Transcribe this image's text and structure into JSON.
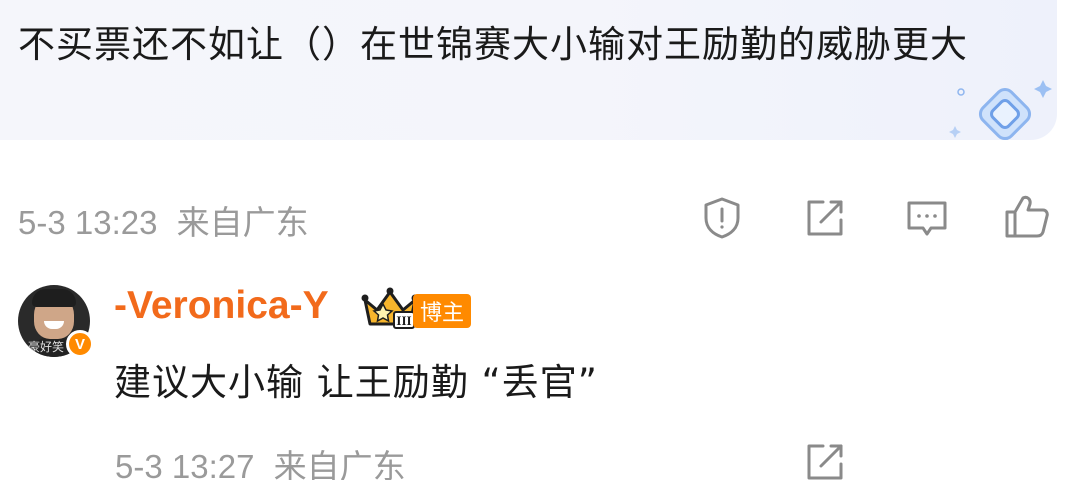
{
  "quoted_comment": {
    "text": "不买票还不如让（）在世锦赛大小输对王励勤的威胁更大"
  },
  "comment_meta": {
    "timestamp": "5-3 13:23",
    "location": "来自广东"
  },
  "actions": {
    "report_icon": "shield-alert-icon",
    "repost_icon": "edit-share-icon",
    "comment_icon": "comment-icon",
    "like_icon": "thumbs-up-icon"
  },
  "reply": {
    "avatar_caption": "豪好笑",
    "verified_mark": "V",
    "username": "-Veronica-Y",
    "crown_level": "III",
    "badge": "博主",
    "text": "建议大小输 让王励勤 “丢官”",
    "timestamp": "5-3 13:27",
    "location": "来自广东"
  },
  "colors": {
    "username": "#f26a1b",
    "badge": "#ff8a00",
    "meta": "#9a9a9a",
    "icon": "#8a8a8a"
  }
}
